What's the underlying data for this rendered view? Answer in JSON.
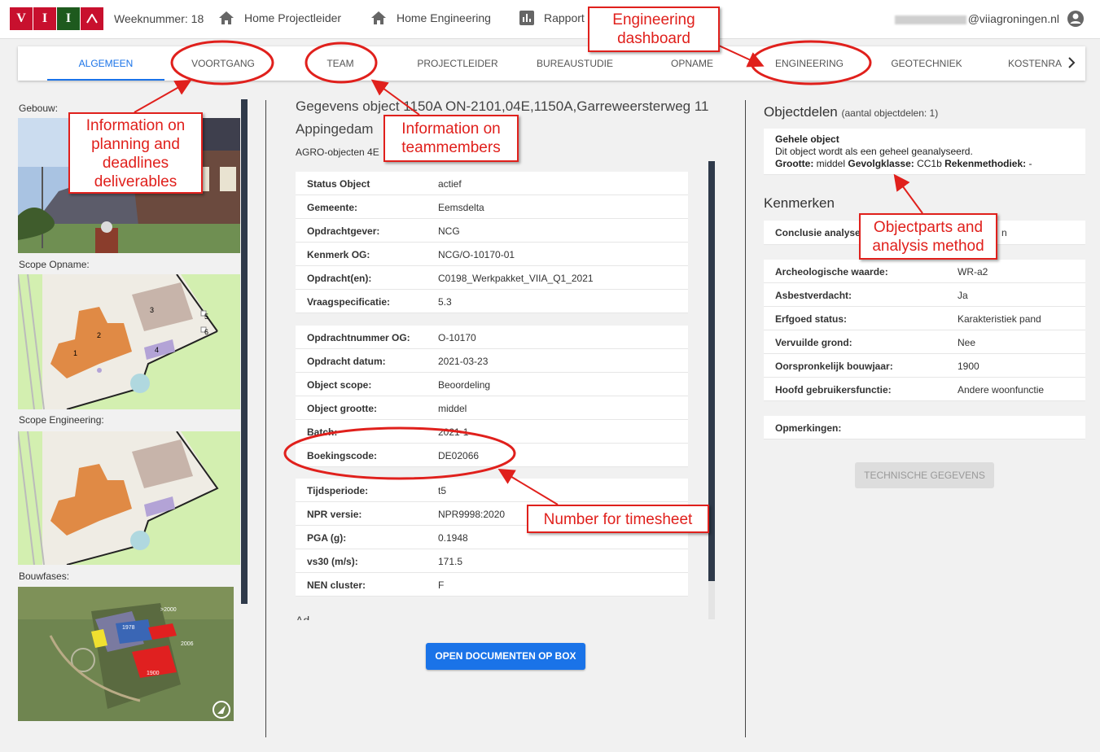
{
  "header": {
    "logo_letters": [
      "V",
      "I",
      "I",
      "A"
    ],
    "logo_colors": [
      "#c8102e",
      "#c8102e",
      "#1e5a1e",
      "#c8102e"
    ],
    "week_label": "Weeknummer: 18",
    "nav": [
      {
        "label": "Home Projectleider",
        "icon": "home-icon"
      },
      {
        "label": "Home Engineering",
        "icon": "home-icon"
      },
      {
        "label": "Rapport",
        "icon": "bar-chart-icon"
      }
    ],
    "email": "@viiagroningen.nl",
    "account_icon": "account-circle-icon"
  },
  "tabs": [
    "ALGEMEEN",
    "VOORTGANG",
    "TEAM",
    "PROJECTLEIDER",
    "BUREAUSTUDIE",
    "OPNAME",
    "ENGINEERING",
    "GEOTECHNIEK",
    "KOSTENRA"
  ],
  "left": {
    "gebouw": "Gebouw:",
    "scope_opname": "Scope Opname:",
    "scope_engineering": "Scope Engineering:",
    "bouwfases": "Bouwfases:",
    "map_labels": [
      "1",
      "2",
      "3",
      "4",
      "5",
      "6"
    ],
    "aerial_labels": [
      "1978",
      "1900",
      ">2000",
      "2006"
    ]
  },
  "object": {
    "title": "Gegevens object 1150A ON-2101,04E,1150A,Garreweersterweg 11 Appingedam",
    "subtitle": "AGRO-objecten 4E",
    "group1": [
      {
        "k": "Status Object",
        "v": "actief"
      },
      {
        "k": "Gemeente:",
        "v": "Eemsdelta"
      },
      {
        "k": "Opdrachtgever:",
        "v": "NCG"
      },
      {
        "k": "Kenmerk OG:",
        "v": "NCG/O-10170-01"
      },
      {
        "k": "Opdracht(en):",
        "v": "C0198_Werkpakket_VIIA_Q1_2021"
      },
      {
        "k": "Vraagspecificatie:",
        "v": "5.3"
      }
    ],
    "group2": [
      {
        "k": "Opdrachtnummer OG:",
        "v": "O-10170"
      },
      {
        "k": "Opdracht datum:",
        "v": "2021-03-23"
      },
      {
        "k": "Object scope:",
        "v": "Beoordeling"
      },
      {
        "k": "Object grootte:",
        "v": "middel"
      },
      {
        "k": "Batch:",
        "v": "2021-1"
      },
      {
        "k": "Boekingscode:",
        "v": "DE02066"
      }
    ],
    "group3": [
      {
        "k": "Tijdsperiode:",
        "v": "t5"
      },
      {
        "k": "NPR versie:",
        "v": "NPR9998:2020"
      },
      {
        "k": "PGA (g):",
        "v": "0.1948"
      },
      {
        "k": "vs30 (m/s):",
        "v": "171.5"
      },
      {
        "k": "NEN cluster:",
        "v": "F"
      }
    ],
    "cut_text": "Ad...",
    "open_docs_button": "OPEN DOCUMENTEN OP BOX"
  },
  "objectdelen": {
    "title": "Objectdelen",
    "count": "(aantal objectdelen: 1)",
    "part_name": "Gehele object",
    "part_desc": "Dit object wordt als een geheel geanalyseerd.",
    "grootte_label": "Grootte:",
    "grootte_value": "middel",
    "gevolgklasse_label": "Gevolgklasse:",
    "gevolgklasse_value": "CC1b",
    "rekenmethodiek_label": "Rekenmethodiek:",
    "rekenmethodiek_value": "-"
  },
  "kenmerken": {
    "title": "Kenmerken",
    "conclusie_label": "Conclusie analyse",
    "conclusie_value_tail": "n",
    "rows": [
      {
        "k": "Archeologische waarde:",
        "v": "WR-a2"
      },
      {
        "k": "Asbestverdacht:",
        "v": "Ja"
      },
      {
        "k": "Erfgoed status:",
        "v": "Karakteristiek pand"
      },
      {
        "k": "Vervuilde grond:",
        "v": "Nee"
      },
      {
        "k": "Oorspronkelijk bouwjaar:",
        "v": "1900"
      },
      {
        "k": "Hoofd gebruikersfunctie:",
        "v": "Andere woonfunctie"
      }
    ],
    "opmerkingen": "Opmerkingen:",
    "tech_button": "TECHNISCHE GEGEVENS"
  },
  "annotations": {
    "engineering_dashboard": "Engineering dashboard",
    "planning": "Information on planning and deadlines deliverables",
    "team": "Information on teammembers",
    "objectparts": "Objectparts and analysis method",
    "timesheet": "Number for timesheet",
    "color": "#e0201c"
  }
}
